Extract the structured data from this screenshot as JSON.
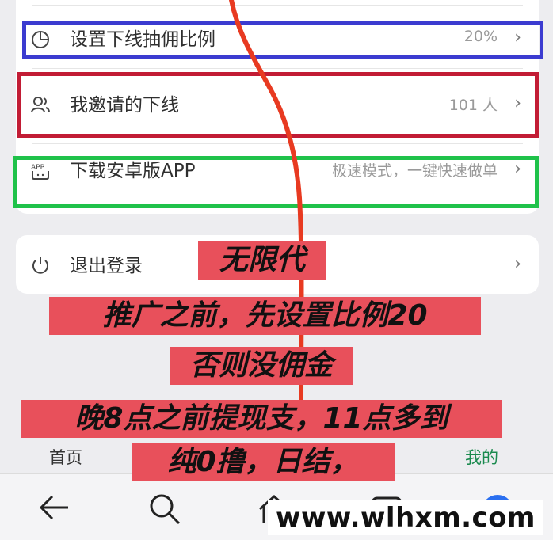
{
  "settings": {
    "rows": [
      {
        "label": "设置下线抽佣比例",
        "value": "20%",
        "icon": "pie-chart-icon"
      },
      {
        "label": "我邀请的下线",
        "value": "101 人",
        "icon": "users-icon"
      },
      {
        "label": "下载安卓版APP",
        "value": "极速模式，一键快速做单",
        "icon": "app-icon",
        "icon_text": "APP"
      }
    ],
    "logout": {
      "label": "退出登录",
      "icon": "power-icon"
    }
  },
  "chevron": "›",
  "banner": {
    "lines": [
      "无限代",
      "推广之前，先设置比例20",
      "否则没佣金",
      "晚8点之前提现支，11点多到",
      "纯0撸，日结，"
    ]
  },
  "tabbar": {
    "home": "首页",
    "mine": "我的"
  },
  "watermark": "www.wlhxm.com",
  "colors": {
    "annotation_blue": "#3b3bd0",
    "annotation_red": "#c21c35",
    "annotation_green": "#1fc24a",
    "banner_bg": "#e8505b",
    "active_tab": "#1a8a4e"
  }
}
